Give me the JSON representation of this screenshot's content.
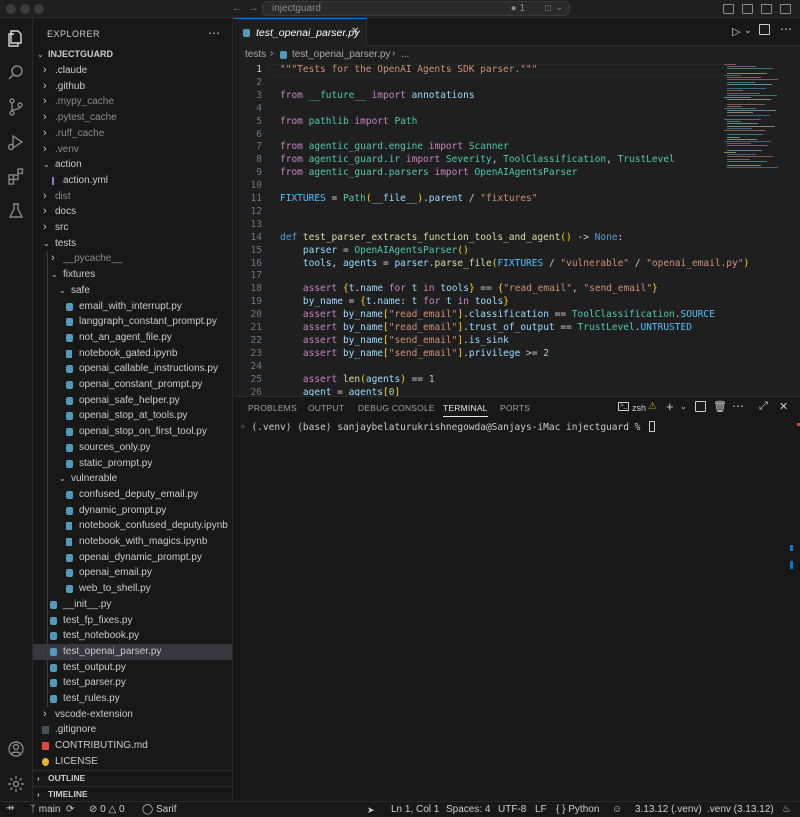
{
  "titlebar": {
    "search_text": "injectguard",
    "notification_count": "1"
  },
  "sidebar": {
    "header": "EXPLORER",
    "root": "INJECTGUARD",
    "tree": [
      {
        "label": ".claude",
        "type": "folder",
        "depth": 1,
        "open": false
      },
      {
        "label": ".github",
        "type": "folder",
        "depth": 1,
        "open": false
      },
      {
        "label": ".mypy_cache",
        "type": "folder",
        "depth": 1,
        "open": false,
        "dim": true
      },
      {
        "label": ".pytest_cache",
        "type": "folder",
        "depth": 1,
        "open": false,
        "dim": true
      },
      {
        "label": ".ruff_cache",
        "type": "folder",
        "depth": 1,
        "open": false,
        "dim": true
      },
      {
        "label": ".venv",
        "type": "folder",
        "depth": 1,
        "open": false,
        "dim": true
      },
      {
        "label": "action",
        "type": "folder",
        "depth": 1,
        "open": true
      },
      {
        "label": "action.yml",
        "type": "yaml",
        "depth": 2
      },
      {
        "label": "dist",
        "type": "folder",
        "depth": 1,
        "open": false,
        "dim": true
      },
      {
        "label": "docs",
        "type": "folder",
        "depth": 1,
        "open": false
      },
      {
        "label": "src",
        "type": "folder",
        "depth": 1,
        "open": false
      },
      {
        "label": "tests",
        "type": "folder",
        "depth": 1,
        "open": true
      },
      {
        "label": "__pycache__",
        "type": "folder",
        "depth": 2,
        "open": false,
        "dim": true
      },
      {
        "label": "fixtures",
        "type": "folder",
        "depth": 2,
        "open": true
      },
      {
        "label": "safe",
        "type": "folder",
        "depth": 3,
        "open": true
      },
      {
        "label": "email_with_interrupt.py",
        "type": "py",
        "depth": 4
      },
      {
        "label": "langgraph_constant_prompt.py",
        "type": "py",
        "depth": 4
      },
      {
        "label": "not_an_agent_file.py",
        "type": "py",
        "depth": 4
      },
      {
        "label": "notebook_gated.ipynb",
        "type": "nb",
        "depth": 4
      },
      {
        "label": "openai_callable_instructions.py",
        "type": "py",
        "depth": 4
      },
      {
        "label": "openai_constant_prompt.py",
        "type": "py",
        "depth": 4
      },
      {
        "label": "openai_safe_helper.py",
        "type": "py",
        "depth": 4
      },
      {
        "label": "openai_stop_at_tools.py",
        "type": "py",
        "depth": 4
      },
      {
        "label": "openai_stop_on_first_tool.py",
        "type": "py",
        "depth": 4
      },
      {
        "label": "sources_only.py",
        "type": "py",
        "depth": 4
      },
      {
        "label": "static_prompt.py",
        "type": "py",
        "depth": 4
      },
      {
        "label": "vulnerable",
        "type": "folder",
        "depth": 3,
        "open": true
      },
      {
        "label": "confused_deputy_email.py",
        "type": "py",
        "depth": 4
      },
      {
        "label": "dynamic_prompt.py",
        "type": "py",
        "depth": 4
      },
      {
        "label": "notebook_confused_deputy.ipynb",
        "type": "nb",
        "depth": 4
      },
      {
        "label": "notebook_with_magics.ipynb",
        "type": "nb",
        "depth": 4
      },
      {
        "label": "openai_dynamic_prompt.py",
        "type": "py",
        "depth": 4
      },
      {
        "label": "openai_email.py",
        "type": "py",
        "depth": 4
      },
      {
        "label": "web_to_shell.py",
        "type": "py",
        "depth": 4
      },
      {
        "label": "__init__.py",
        "type": "py",
        "depth": 2
      },
      {
        "label": "test_fp_fixes.py",
        "type": "py",
        "depth": 2
      },
      {
        "label": "test_notebook.py",
        "type": "py",
        "depth": 2
      },
      {
        "label": "test_openai_parser.py",
        "type": "py",
        "depth": 2,
        "selected": true
      },
      {
        "label": "test_output.py",
        "type": "py",
        "depth": 2
      },
      {
        "label": "test_parser.py",
        "type": "py",
        "depth": 2
      },
      {
        "label": "test_rules.py",
        "type": "py",
        "depth": 2
      },
      {
        "label": "vscode-extension",
        "type": "folder",
        "depth": 1,
        "open": false
      },
      {
        "label": ".gitignore",
        "type": "git",
        "depth": 1
      },
      {
        "label": "CONTRIBUTING.md",
        "type": "md",
        "depth": 1
      },
      {
        "label": "LICENSE",
        "type": "license",
        "depth": 1
      }
    ],
    "outline_label": "OUTLINE",
    "timeline_label": "TIMELINE"
  },
  "editor": {
    "tab_label": "test_openai_parser.py",
    "breadcrumb": {
      "folder": "tests",
      "file": "test_openai_parser.py",
      "more": "..."
    },
    "current_line": 1,
    "lines": [
      {
        "n": "1",
        "html": "<span class=\"s\">\"\"\"Tests for the OpenAI Agents SDK parser.\"\"\"</span>"
      },
      {
        "n": "2",
        "html": ""
      },
      {
        "n": "3",
        "html": "<span class=\"k\">from</span> <span class=\"c\">__future__</span> <span class=\"k\">import</span> <span class=\"v\">annotations</span>"
      },
      {
        "n": "4",
        "html": ""
      },
      {
        "n": "5",
        "html": "<span class=\"k\">from</span> <span class=\"c\">pathlib</span> <span class=\"k\">import</span> <span class=\"c\">Path</span>"
      },
      {
        "n": "6",
        "html": ""
      },
      {
        "n": "7",
        "html": "<span class=\"k\">from</span> <span class=\"c\">agentic_guard.engine</span> <span class=\"k\">import</span> <span class=\"c\">Scanner</span>"
      },
      {
        "n": "8",
        "html": "<span class=\"k\">from</span> <span class=\"c\">agentic_guard.ir</span> <span class=\"k\">import</span> <span class=\"c\">Severity</span>, <span class=\"c\">ToolClassification</span>, <span class=\"c\">TrustLevel</span>"
      },
      {
        "n": "9",
        "html": "<span class=\"k\">from</span> <span class=\"c\">agentic_guard.parsers</span> <span class=\"k\">import</span> <span class=\"c\">OpenAIAgentsParser</span>"
      },
      {
        "n": "10",
        "html": ""
      },
      {
        "n": "11",
        "html": "<span class=\"cn\">FIXTURES</span> = <span class=\"c\">Path</span><span class=\"br\">(</span><span class=\"v\">__file__</span><span class=\"br\">)</span>.<span class=\"v\">parent</span> / <span class=\"s\">\"fixtures\"</span>"
      },
      {
        "n": "12",
        "html": ""
      },
      {
        "n": "13",
        "html": ""
      },
      {
        "n": "14",
        "html": "<span class=\"b\">def</span> <span class=\"f\">test_parser_extracts_function_tools_and_agent</span><span class=\"br\">()</span> -&gt; <span class=\"b\">None</span>:"
      },
      {
        "n": "15",
        "html": "    <span class=\"v\">parser</span> = <span class=\"c\">OpenAIAgentsParser</span><span class=\"br\">()</span>"
      },
      {
        "n": "16",
        "html": "    <span class=\"v\">tools</span>, <span class=\"v\">agents</span> = <span class=\"v\">parser</span>.<span class=\"f\">parse_file</span><span class=\"br\">(</span><span class=\"cn\">FIXTURES</span> / <span class=\"s\">\"vulnerable\"</span> / <span class=\"s\">\"openai_email.py\"</span><span class=\"br\">)</span>"
      },
      {
        "n": "17",
        "html": ""
      },
      {
        "n": "18",
        "html": "    <span class=\"k\">assert</span> <span class=\"br\">{</span><span class=\"v\">t</span>.<span class=\"v\">name</span> <span class=\"k\">for</span> <span class=\"v\">t</span> <span class=\"k\">in</span> <span class=\"v\">tools</span><span class=\"br\">}</span> == <span class=\"br\">{</span><span class=\"s\">\"read_email\"</span>, <span class=\"s\">\"send_email\"</span><span class=\"br\">}</span>"
      },
      {
        "n": "19",
        "html": "    <span class=\"v\">by_name</span> = <span class=\"br\">{</span><span class=\"v\">t</span>.<span class=\"v\">name</span>: <span class=\"v\">t</span> <span class=\"k\">for</span> <span class=\"v\">t</span> <span class=\"k\">in</span> <span class=\"v\">tools</span><span class=\"br\">}</span>"
      },
      {
        "n": "20",
        "html": "    <span class=\"k\">assert</span> <span class=\"v\">by_name</span><span class=\"br\">[</span><span class=\"s\">\"read_email\"</span><span class=\"br\">]</span>.<span class=\"v\">classification</span> == <span class=\"c\">ToolClassification</span>.<span class=\"cn\">SOURCE</span>"
      },
      {
        "n": "21",
        "html": "    <span class=\"k\">assert</span> <span class=\"v\">by_name</span><span class=\"br\">[</span><span class=\"s\">\"read_email\"</span><span class=\"br\">]</span>.<span class=\"v\">trust_of_output</span> == <span class=\"c\">TrustLevel</span>.<span class=\"cn\">UNTRUSTED</span>"
      },
      {
        "n": "22",
        "html": "    <span class=\"k\">assert</span> <span class=\"v\">by_name</span><span class=\"br\">[</span><span class=\"s\">\"send_email\"</span><span class=\"br\">]</span>.<span class=\"v\">is_sink</span>"
      },
      {
        "n": "23",
        "html": "    <span class=\"k\">assert</span> <span class=\"v\">by_name</span><span class=\"br\">[</span><span class=\"s\">\"send_email\"</span><span class=\"br\">]</span>.<span class=\"v\">privilege</span> &gt;= <span class=\"n\">2</span>"
      },
      {
        "n": "24",
        "html": ""
      },
      {
        "n": "25",
        "html": "    <span class=\"k\">assert</span> <span class=\"f\">len</span><span class=\"br\">(</span><span class=\"v\">agents</span><span class=\"br\">)</span> == <span class=\"n\">1</span>"
      },
      {
        "n": "26",
        "html": "    <span class=\"v\">agent</span> = <span class=\"v\">agents</span><span class=\"br\">[</span><span class=\"n\">0</span><span class=\"br\">]</span>"
      }
    ]
  },
  "panel": {
    "tabs": [
      "PROBLEMS",
      "OUTPUT",
      "DEBUG CONSOLE",
      "TERMINAL",
      "PORTS"
    ],
    "active_tab": "TERMINAL",
    "shell_label": "zsh",
    "terminal_prompt": "(.venv) (base) sanjaybelaturukrishnegowda@Sanjays-iMac injectguard % "
  },
  "status": {
    "branch": "main",
    "errors": "0",
    "warnings": "0",
    "sarif": "Sarif",
    "position": "Ln 1, Col 1",
    "spaces": "Spaces: 4",
    "encoding": "UTF-8",
    "eol": "LF",
    "language": "Python",
    "interpreter": "3.13.12 (.venv)",
    "env": ".venv (3.13.12)"
  },
  "colors": {
    "accent": "#0078d4",
    "python_icon": "#519aba",
    "notebook_icon": "#519aba",
    "yaml_icon": "#a074c4",
    "md_icon": "#e8b52e"
  }
}
